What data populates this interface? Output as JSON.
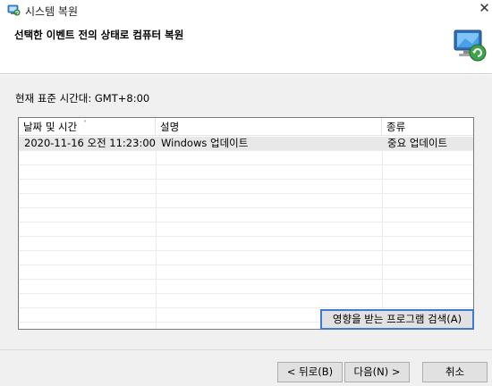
{
  "window": {
    "title": "시스템 복원",
    "close_glyph": "✕"
  },
  "header": {
    "heading": "선택한 이벤트 전의 상태로 컴퓨터 복원"
  },
  "content": {
    "timezone_label": "현재 표준 시간대: GMT+8:00",
    "columns": [
      "날짜 및 시간",
      "설명",
      "종류"
    ],
    "sort_glyph": "˅",
    "rows": [
      {
        "date": "2020-11-16 오전 11:23:00",
        "description": "Windows 업데이트",
        "type": "중요 업데이트"
      }
    ],
    "scan_button": "영향을 받는 프로그램 검색(A)"
  },
  "footer": {
    "back_button": "< 뒤로(B)",
    "next_button": "다음(N) >",
    "cancel_button": "취소"
  },
  "icons": {
    "app": "system-restore-icon",
    "wizard": "system-restore-computer-icon"
  }
}
